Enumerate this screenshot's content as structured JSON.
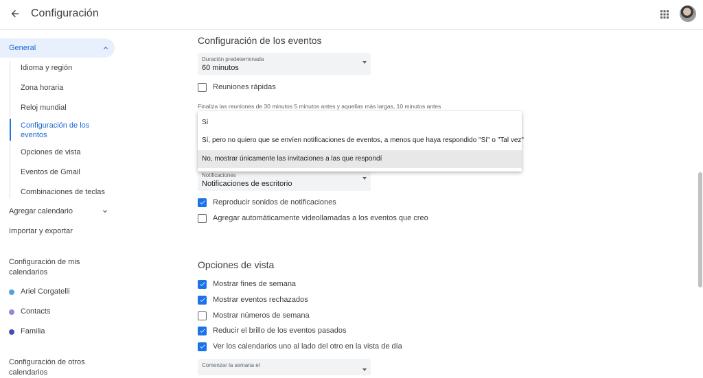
{
  "header": {
    "title": "Configuración",
    "back_icon": "arrow-back-icon",
    "apps_icon": "apps-grid-icon"
  },
  "sidebar": {
    "general": "General",
    "general_items": [
      "Idioma y región",
      "Zona horaria",
      "Reloj mundial",
      "Configuración de los eventos",
      "Opciones de vista",
      "Eventos de Gmail",
      "Combinaciones de teclas"
    ],
    "add_calendar": "Agregar calendario",
    "import_export": "Importar y exportar",
    "my_calendars_title": "Configuración de mis calendarios",
    "my_calendars": [
      {
        "name": "Ariel Corgatelli",
        "color": "#4fa3e0"
      },
      {
        "name": "Contacts",
        "color": "#8e8cd8"
      },
      {
        "name": "Familia",
        "color": "#3f51b5"
      }
    ],
    "other_calendars_title": "Configuración de otros calendarios"
  },
  "event_settings": {
    "title": "Configuración de los eventos",
    "duration_label": "Duración predeterminada",
    "duration_value": "60 minutos",
    "quick_meetings": "Reuniones rápidas",
    "quick_meetings_hint": "Finaliza las reuniones de 30 minutos 5 minutos antes y aquellas más largas, 10 minutos antes",
    "notifications_label": "Notificaciones",
    "notifications_value": "Notificaciones de escritorio",
    "play_sounds": "Reproducir sonidos de notificaciones",
    "auto_videocalls": "Agregar automáticamente videollamadas a los eventos que creo"
  },
  "dropdown": {
    "options": [
      "Sí",
      "Sí, pero no quiero que se envíen notificaciones de eventos, a menos que haya respondido \"Sí\" o \"Tal vez\"",
      "No, mostrar únicamente las invitaciones a las que respondí"
    ],
    "highlighted_index": 2
  },
  "view_options": {
    "title": "Opciones de vista",
    "items": [
      {
        "label": "Mostrar fines de semana",
        "checked": true
      },
      {
        "label": "Mostrar eventos rechazados",
        "checked": true
      },
      {
        "label": "Mostrar números de semana",
        "checked": false
      },
      {
        "label": "Reducir el brillo de los eventos pasados",
        "checked": true
      },
      {
        "label": "Ver los calendarios uno al lado del otro en la vista de día",
        "checked": true
      }
    ],
    "week_start_label": "Comenzar la semana el"
  },
  "colors": {
    "accent": "#1a73e8",
    "active_bg": "#e8f0fe",
    "active_text": "#1967d2"
  }
}
